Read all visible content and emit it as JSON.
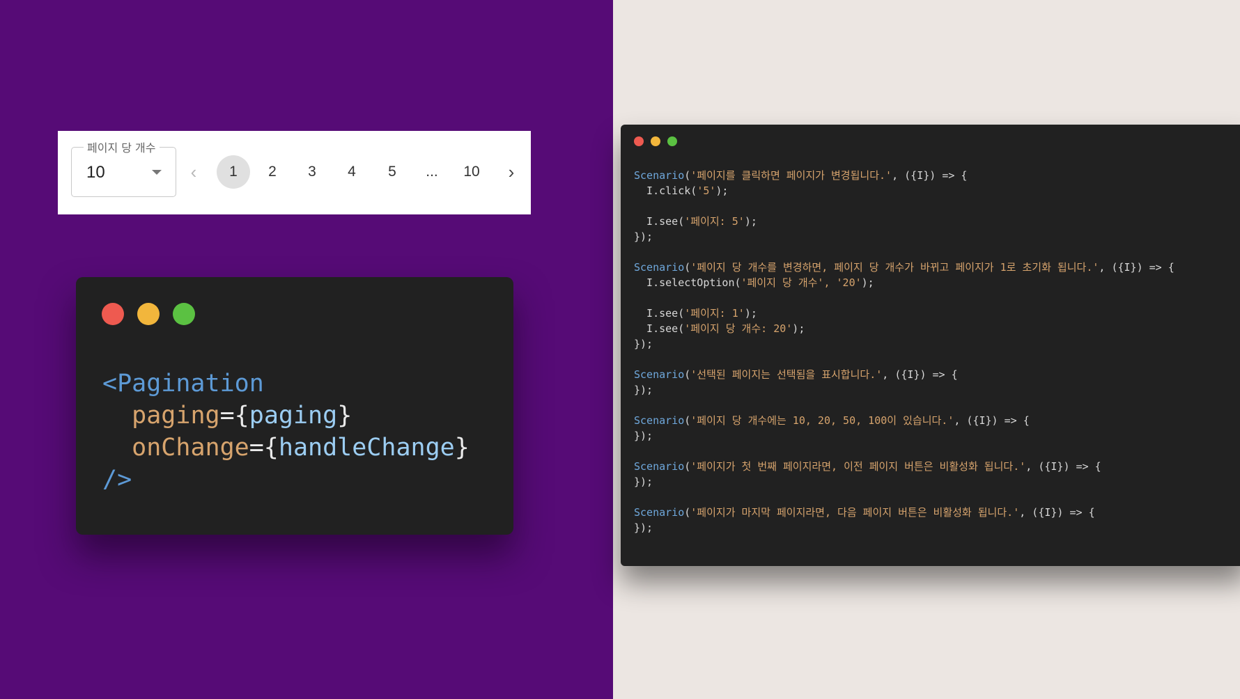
{
  "pagination_widget": {
    "page_size_label": "페이지 당 개수",
    "page_size_value": "10",
    "prev_icon": "chevron-left-icon",
    "next_icon": "chevron-right-icon",
    "pages": [
      "1",
      "2",
      "3",
      "4",
      "5",
      "...",
      "10"
    ],
    "active_page": "1"
  },
  "small_code_window": {
    "window_controls": [
      "red",
      "yellow",
      "green"
    ],
    "lines": [
      {
        "tag_open": "<Pagination"
      },
      {
        "attr": "paging",
        "eq": "={",
        "value": "paging",
        "close": "}"
      },
      {
        "attr": "onChange",
        "eq": "={",
        "value": "handleChange",
        "close": "}"
      },
      {
        "tag_close": "/>"
      }
    ]
  },
  "large_code_window": {
    "window_controls": [
      "red",
      "yellow",
      "green"
    ],
    "scenarios": [
      {
        "keyword": "Scenario",
        "title": "'페이지를 클릭하면 페이지가 변경됩니다.'",
        "args": ", ({I}) => {",
        "body": [
          {
            "call": "  I.click(",
            "arg": "'5'",
            "end": ");"
          },
          {
            "blank": true
          },
          {
            "call": "  I.see(",
            "arg": "'페이지: 5'",
            "end": ");"
          }
        ],
        "closer": "});"
      },
      {
        "keyword": "Scenario",
        "title": "'페이지 당 개수를 변경하면, 페이지 당 개수가 바뀌고 페이지가 1로 초기화 됩니다.'",
        "args": ", ({I}) => {",
        "body": [
          {
            "call": "  I.selectOption(",
            "arg": "'페이지 당 개수', '20'",
            "end": ");"
          },
          {
            "blank": true
          },
          {
            "call": "  I.see(",
            "arg": "'페이지: 1'",
            "end": ");"
          },
          {
            "call": "  I.see(",
            "arg": "'페이지 당 개수: 20'",
            "end": ");"
          }
        ],
        "closer": "});"
      },
      {
        "keyword": "Scenario",
        "title": "'선택된 페이지는 선택됨을 표시합니다.'",
        "args": ", ({I}) => {",
        "body": [],
        "closer": "});"
      },
      {
        "keyword": "Scenario",
        "title": "'페이지 당 개수에는 10, 20, 50, 100이 있습니다.'",
        "args": ", ({I}) => {",
        "body": [],
        "closer": "});"
      },
      {
        "keyword": "Scenario",
        "title": "'페이지가 첫 번째 페이지라면, 이전 페이지 버튼은 비활성화 됩니다.'",
        "args": ", ({I}) => {",
        "body": [],
        "closer": "});"
      },
      {
        "keyword": "Scenario",
        "title": "'페이지가 마지막 페이지라면, 다음 페이지 버튼은 비활성화 됩니다.'",
        "args": ", ({I}) => {",
        "body": [],
        "closer": "});"
      }
    ]
  },
  "colors": {
    "left_background": "#560b76",
    "right_background": "#ece6e2",
    "code_background": "#212121",
    "keyword": "#6fa8dc",
    "string": "#d7a46d"
  }
}
